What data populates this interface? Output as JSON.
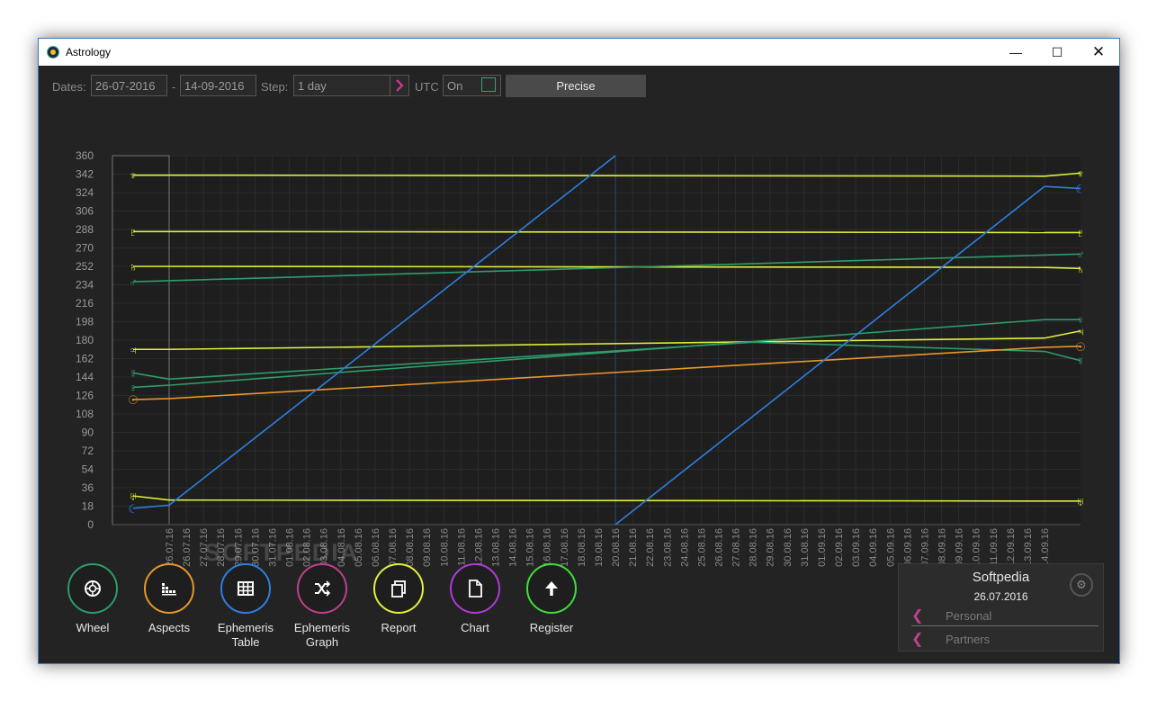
{
  "window": {
    "title": "Astrology"
  },
  "toolbar": {
    "dates_label": "Dates:",
    "date_from": "26-07-2016",
    "date_sep": "-",
    "date_to": "14-09-2016",
    "step_label": "Step:",
    "step_value": "1 day",
    "utc_label": "UTC",
    "utc_value": "On",
    "precise_label": "Precise"
  },
  "colors": {
    "yellow": "#e2ef3a",
    "green": "#2e9c6a",
    "blue": "#2d7fe0",
    "orange": "#e8962a",
    "purple_chevron": "#c0408c"
  },
  "chart_data": {
    "type": "line",
    "y_ticks": [
      "0",
      "18",
      "36",
      "54",
      "72",
      "90",
      "108",
      "126",
      "144",
      "162",
      "180",
      "198",
      "216",
      "234",
      "252",
      "270",
      "288",
      "306",
      "324",
      "342",
      "360"
    ],
    "ylim": [
      0,
      360
    ],
    "x_labels": [
      "26.07.16",
      "26.07.16",
      "27.07.16",
      "28.07.16",
      "29.07.16",
      "30.07.16",
      "31.07.16",
      "01.08.16",
      "02.08.16",
      "03.08.16",
      "04.08.16",
      "05.08.16",
      "06.08.16",
      "07.08.16",
      "08.08.16",
      "09.08.16",
      "10.08.16",
      "11.08.16",
      "12.08.16",
      "13.08.16",
      "14.08.16",
      "15.08.16",
      "16.08.16",
      "17.08.16",
      "18.08.16",
      "19.08.16",
      "20.08.16",
      "21.08.16",
      "22.08.16",
      "23.08.16",
      "24.08.16",
      "25.08.16",
      "26.08.16",
      "27.08.16",
      "28.08.16",
      "29.08.16",
      "30.08.16",
      "31.08.16",
      "01.09.16",
      "02.09.16",
      "03.09.16",
      "04.09.16",
      "05.09.16",
      "06.09.16",
      "07.09.16",
      "08.09.16",
      "09.09.16",
      "10.09.16",
      "11.09.16",
      "12.09.16",
      "13.09.16",
      "14.09.16"
    ],
    "series": [
      {
        "symbol": "♆",
        "color": "#e2ef3a",
        "start": 341,
        "values": [
          341,
          340
        ],
        "end": 343
      },
      {
        "symbol": "♇",
        "color": "#e2ef3a",
        "start": 286,
        "values": [
          286,
          285
        ],
        "end": 285
      },
      {
        "symbol": "♄",
        "color": "#e2ef3a",
        "start": 252,
        "values": [
          252,
          251
        ],
        "end": 250
      },
      {
        "symbol": "♂",
        "color": "#2e9c6a",
        "start": 237,
        "values": [
          238,
          263
        ],
        "end": 264
      },
      {
        "symbol": "♃",
        "color": "#e2ef3a",
        "start": 171,
        "values": [
          171,
          182
        ],
        "end": 189
      },
      {
        "symbol": "♀",
        "color": "#2e9c6a",
        "start": 134,
        "values": [
          136,
          200
        ],
        "end": 200
      },
      {
        "symbol": "☿",
        "color": "#2e9c6a",
        "start": 148,
        "values": [
          142,
          178,
          169
        ],
        "end": 160
      },
      {
        "symbol": "☉",
        "color": "#e8962a",
        "start": 122,
        "values": [
          123,
          173
        ],
        "end": 174
      },
      {
        "symbol": "♅",
        "color": "#e2ef3a",
        "start": 28,
        "values": [
          24,
          23
        ],
        "end": 23
      },
      {
        "symbol": "☾",
        "color": "#2d7fe0",
        "start": 16,
        "values": [
          19,
          360,
          0,
          330
        ],
        "end": 328
      }
    ]
  },
  "watermark": "SOFTPEDIA",
  "nav": [
    {
      "label": "Wheel",
      "color": "#2e9c6a",
      "icon": "wheel-icon"
    },
    {
      "label": "Aspects",
      "color": "#e8962a",
      "icon": "aspects-icon"
    },
    {
      "label": "Ephemeris Table",
      "color": "#2d7fe0",
      "icon": "table-icon"
    },
    {
      "label": "Ephemeris Graph",
      "color": "#c0408c",
      "icon": "shuffle-icon"
    },
    {
      "label": "Report",
      "color": "#e2ef3a",
      "icon": "report-icon"
    },
    {
      "label": "Chart",
      "color": "#b03ad8",
      "icon": "document-icon"
    },
    {
      "label": "Register",
      "color": "#3ce03c",
      "icon": "arrow-up-icon"
    }
  ],
  "profile": {
    "name": "Softpedia",
    "date": "26.07.2016",
    "items": [
      "Personal",
      "Partners"
    ]
  }
}
